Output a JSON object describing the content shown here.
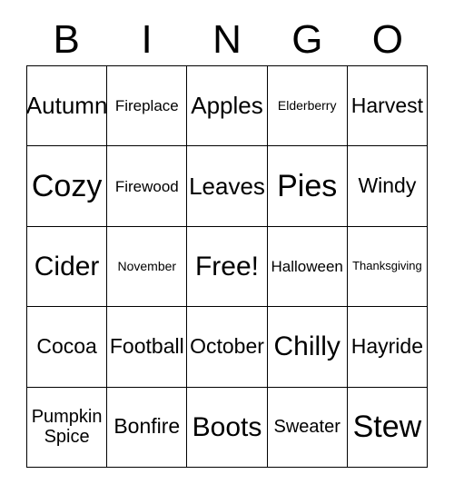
{
  "card": {
    "header_letters": [
      "B",
      "I",
      "N",
      "G",
      "O"
    ],
    "free_space_label": "Free!",
    "colors": {
      "background": "#ffffff",
      "text": "#000000",
      "grid_line": "#000000"
    },
    "rows": [
      [
        {
          "label": "Autumn",
          "size": "lg"
        },
        {
          "label": "Fireplace",
          "size": "xs"
        },
        {
          "label": "Apples",
          "size": "lg"
        },
        {
          "label": "Elderberry",
          "size": "xxs"
        },
        {
          "label": "Harvest",
          "size": "md"
        }
      ],
      [
        {
          "label": "Cozy",
          "size": "xxl"
        },
        {
          "label": "Firewood",
          "size": "xs"
        },
        {
          "label": "Leaves",
          "size": "lg"
        },
        {
          "label": "Pies",
          "size": "xxl"
        },
        {
          "label": "Windy",
          "size": "md"
        }
      ],
      [
        {
          "label": "Cider",
          "size": "xl"
        },
        {
          "label": "November",
          "size": "xxs"
        },
        {
          "label": "Free!",
          "size": "xl"
        },
        {
          "label": "Halloween",
          "size": "xs"
        },
        {
          "label": "Thanksgiving",
          "size": "tiny"
        }
      ],
      [
        {
          "label": "Cocoa",
          "size": "md"
        },
        {
          "label": "Football",
          "size": "md"
        },
        {
          "label": "October",
          "size": "md"
        },
        {
          "label": "Chilly",
          "size": "xl"
        },
        {
          "label": "Hayride",
          "size": "md"
        }
      ],
      [
        {
          "label": "Pumpkin\nSpice",
          "size": "two-line"
        },
        {
          "label": "Bonfire",
          "size": "md"
        },
        {
          "label": "Boots",
          "size": "xl"
        },
        {
          "label": "Sweater",
          "size": "sm"
        },
        {
          "label": "Stew",
          "size": "xxl"
        }
      ]
    ]
  }
}
